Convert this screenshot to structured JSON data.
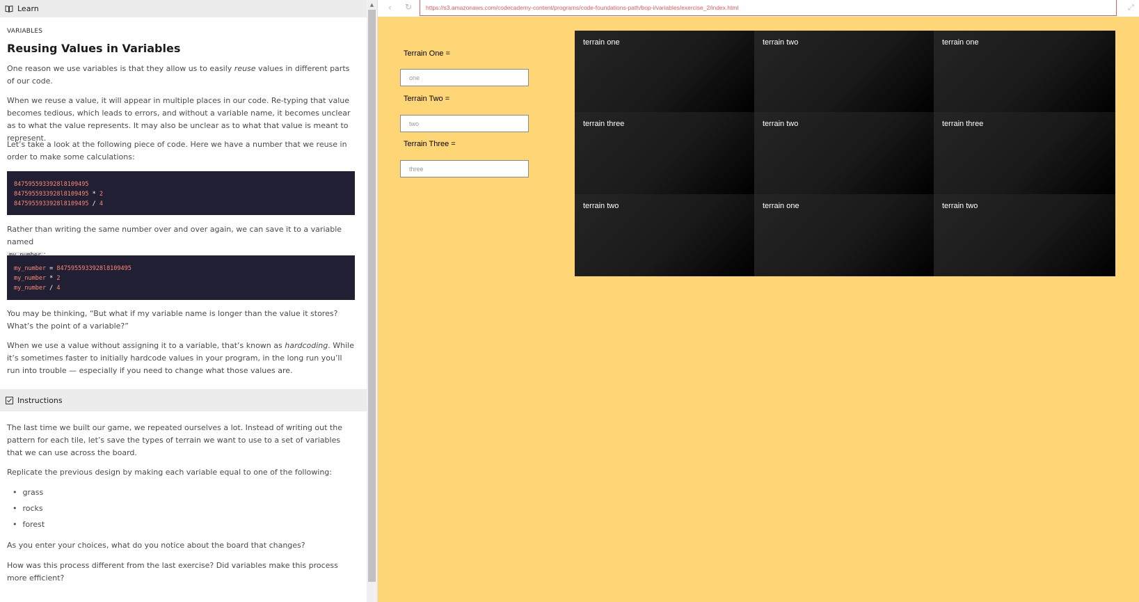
{
  "learn": {
    "header_label": "Learn",
    "eyebrow": "VARIABLES",
    "title": "Reusing Values in Variables",
    "p1_a": "One reason we use variables is that they allow us to easily ",
    "p1_em": "reuse",
    "p1_b": " values in different parts of our code.",
    "p2": "When we reuse a value, it will appear in multiple places in our code. Re-typing that value becomes tedious, which leads to errors, and without a variable name, it becomes unclear as to what the value represents. It may also be unclear as to what that value is meant to represent.",
    "p3": "Let’s take a look at the following piece of code. Here we have a number that we reuse in order to make some calculations:",
    "code1": {
      "line1_num": "8475955933928l8109495",
      "line2_num": "8475955933928l8109495",
      "line2_op": " * ",
      "line2_val": "2",
      "line3_num": "8475955933928l8109495",
      "line3_op": " / ",
      "line3_val": "4"
    },
    "p4": "Rather than writing the same number over and over again, we can save it to a variable named",
    "p4_code": "my_number",
    "p4_end": ":",
    "code2": {
      "line1_var": "my_number",
      "line1_op": " = ",
      "line1_val": "8475955933928l8109495",
      "line2_var": "my_number",
      "line2_op": " * ",
      "line2_val": "2",
      "line3_var": "my_number",
      "line3_op": " / ",
      "line3_val": "4"
    },
    "p5": "You may be thinking, “But what if my variable name is longer than the value it stores? What’s the point of a variable?”",
    "p6_a": "When we use a value without assigning it to a variable, that’s known as ",
    "p6_em": "hardcoding",
    "p6_b": ". While it’s sometimes faster to initially hardcode values in your program, in the long run you’ll run into trouble — especially if you need to change what those values are."
  },
  "instructions": {
    "header_label": "Instructions",
    "p1": "The last time we built our game, we repeated ourselves a lot. Instead of writing out the pattern for each tile, let’s save the types of terrain we want to use to a set of variables that we can use across the board.",
    "p2": "Replicate the previous design by making each variable equal to one of the following:",
    "options": [
      "grass",
      "rocks",
      "forest"
    ],
    "p3": "As you enter your choices, what do you notice about the board that changes?",
    "p4": "How was this process different from the last exercise? Did variables make this process more efficient?"
  },
  "browser": {
    "url": "https://s3.amazonaws.com/codecademy-content/programs/code-foundations-path/bop-i/variables/exercise_2/index.html",
    "back_glyph": "‹",
    "reload_glyph": "↻",
    "expand_glyph": "⤢"
  },
  "form": {
    "terrain_one_label": "Terrain One =",
    "terrain_one_placeholder": "one",
    "terrain_two_label": "Terrain Two =",
    "terrain_two_placeholder": "two",
    "terrain_three_label": "Terrain Three =",
    "terrain_three_placeholder": "three"
  },
  "board": {
    "tiles": [
      "terrain one",
      "terrain two",
      "terrain one",
      "terrain three",
      "terrain two",
      "terrain three",
      "terrain two",
      "terrain one",
      "terrain two"
    ]
  },
  "colors": {
    "preview_bg": "#ffd675",
    "code_bg": "#211f33",
    "code_accent": "#ff8973",
    "url_accent": "#e15a5a"
  }
}
